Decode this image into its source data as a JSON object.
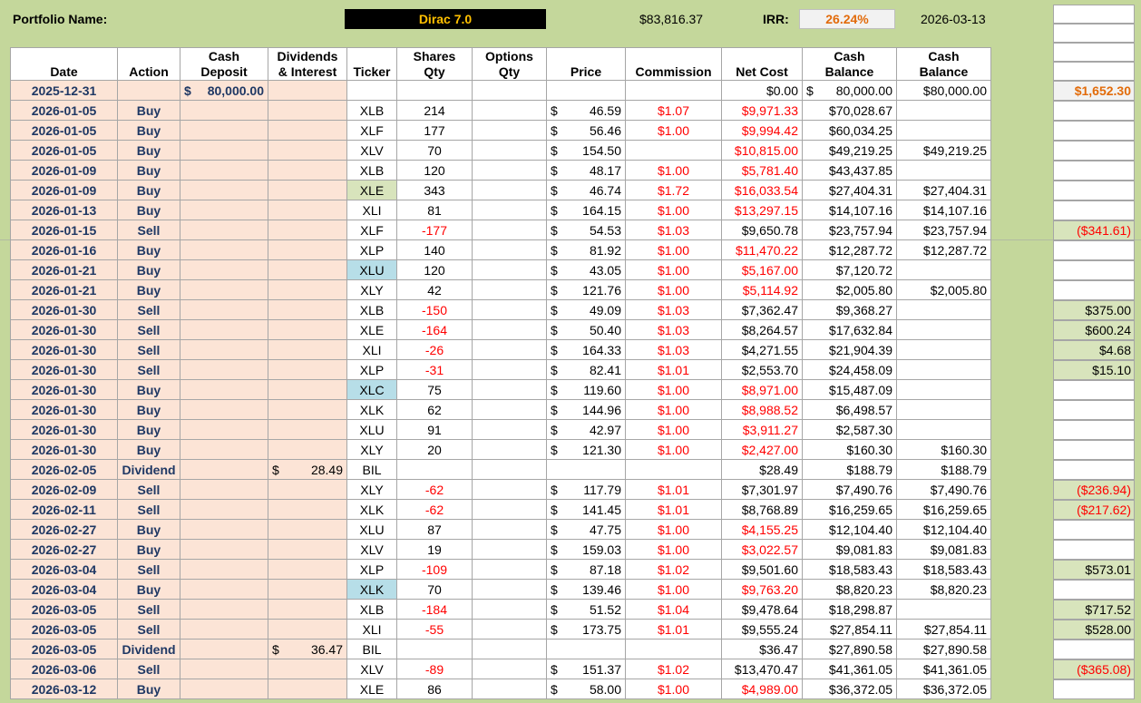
{
  "header": {
    "portfolio_label": "Portfolio Name:",
    "portfolio_name": "Dirac 7.0",
    "total_value": "$83,816.37",
    "irr_label": "IRR:",
    "irr_value": "26.24%",
    "as_of_date": "2026-03-13"
  },
  "columns": {
    "date": "Date",
    "action": "Action",
    "cash_deposit_1": "Cash",
    "cash_deposit_2": "Deposit",
    "dividends_1": "Dividends",
    "dividends_2": "& Interest",
    "ticker": "Ticker",
    "shares_1": "Shares",
    "shares_2": "Qty",
    "options_1": "Options",
    "options_2": "Qty",
    "price": "Price",
    "commission": "Commission",
    "net_cost": "Net Cost",
    "cash_balance_1": "Cash",
    "cash_balance_1b": "Balance",
    "cash_balance_2": "Cash",
    "cash_balance_2b": "Balance"
  },
  "rows": [
    {
      "date": "2025-12-31",
      "action": "",
      "deposit_cur": "$",
      "deposit": "80,000.00",
      "div_cur": "",
      "div": "",
      "ticker": "",
      "ticker_hl": "",
      "shares": "",
      "price_cur": "",
      "price": "",
      "comm": "",
      "net": "$0.00",
      "net_neg": false,
      "cb1_cur": "$",
      "cb1": "80,000.00",
      "cb2": "$80,000.00",
      "side": "$1,652.30",
      "side_style": "orange"
    },
    {
      "date": "2026-01-05",
      "action": "Buy",
      "deposit_cur": "",
      "deposit": "",
      "div_cur": "",
      "div": "",
      "ticker": "XLB",
      "ticker_hl": "",
      "shares": "214",
      "price_cur": "$",
      "price": "46.59",
      "comm": "$1.07",
      "net": "$9,971.33",
      "net_neg": true,
      "cb1_cur": "",
      "cb1": "$70,028.67",
      "cb2": "",
      "side": "",
      "side_style": "blank"
    },
    {
      "date": "2026-01-05",
      "action": "Buy",
      "deposit_cur": "",
      "deposit": "",
      "div_cur": "",
      "div": "",
      "ticker": "XLF",
      "ticker_hl": "",
      "shares": "177",
      "price_cur": "$",
      "price": "56.46",
      "comm": "$1.00",
      "net": "$9,994.42",
      "net_neg": true,
      "cb1_cur": "",
      "cb1": "$60,034.25",
      "cb2": "",
      "side": "",
      "side_style": "blank"
    },
    {
      "date": "2026-01-05",
      "action": "Buy",
      "deposit_cur": "",
      "deposit": "",
      "div_cur": "",
      "div": "",
      "ticker": "XLV",
      "ticker_hl": "",
      "shares": "70",
      "price_cur": "$",
      "price": "154.50",
      "comm": "",
      "net": "$10,815.00",
      "net_neg": true,
      "cb1_cur": "",
      "cb1": "$49,219.25",
      "cb2": "$49,219.25",
      "side": "",
      "side_style": "blank"
    },
    {
      "date": "2026-01-09",
      "action": "Buy",
      "deposit_cur": "",
      "deposit": "",
      "div_cur": "",
      "div": "",
      "ticker": "XLB",
      "ticker_hl": "",
      "shares": "120",
      "price_cur": "$",
      "price": "48.17",
      "comm": "$1.00",
      "net": "$5,781.40",
      "net_neg": true,
      "cb1_cur": "",
      "cb1": "$43,437.85",
      "cb2": "",
      "side": "",
      "side_style": "blank"
    },
    {
      "date": "2026-01-09",
      "action": "Buy",
      "deposit_cur": "",
      "deposit": "",
      "div_cur": "",
      "div": "",
      "ticker": "XLE",
      "ticker_hl": "green",
      "shares": "343",
      "price_cur": "$",
      "price": "46.74",
      "comm": "$1.72",
      "net": "$16,033.54",
      "net_neg": true,
      "cb1_cur": "",
      "cb1": "$27,404.31",
      "cb2": "$27,404.31",
      "side": "",
      "side_style": "blank"
    },
    {
      "date": "2026-01-13",
      "action": "Buy",
      "deposit_cur": "",
      "deposit": "",
      "div_cur": "",
      "div": "",
      "ticker": "XLI",
      "ticker_hl": "",
      "shares": "81",
      "price_cur": "$",
      "price": "164.15",
      "comm": "$1.00",
      "net": "$13,297.15",
      "net_neg": true,
      "cb1_cur": "",
      "cb1": "$14,107.16",
      "cb2": "$14,107.16",
      "side": "",
      "side_style": "blank"
    },
    {
      "date": "2026-01-15",
      "action": "Sell",
      "deposit_cur": "",
      "deposit": "",
      "div_cur": "",
      "div": "",
      "ticker": "XLF",
      "ticker_hl": "",
      "shares": "-177",
      "price_cur": "$",
      "price": "54.53",
      "comm": "$1.03",
      "net": "$9,650.78",
      "net_neg": false,
      "cb1_cur": "",
      "cb1": "$23,757.94",
      "cb2": "$23,757.94",
      "side": "($341.61)",
      "side_style": "loss"
    },
    {
      "date": "2026-01-16",
      "action": "Buy",
      "deposit_cur": "",
      "deposit": "",
      "div_cur": "",
      "div": "",
      "ticker": "XLP",
      "ticker_hl": "",
      "shares": "140",
      "price_cur": "$",
      "price": "81.92",
      "comm": "$1.00",
      "net": "$11,470.22",
      "net_neg": true,
      "cb1_cur": "",
      "cb1": "$12,287.72",
      "cb2": "$12,287.72",
      "side": "",
      "side_style": "blank"
    },
    {
      "date": "2026-01-21",
      "action": "Buy",
      "deposit_cur": "",
      "deposit": "",
      "div_cur": "",
      "div": "",
      "ticker": "XLU",
      "ticker_hl": "blue",
      "shares": "120",
      "price_cur": "$",
      "price": "43.05",
      "comm": "$1.00",
      "net": "$5,167.00",
      "net_neg": true,
      "cb1_cur": "",
      "cb1": "$7,120.72",
      "cb2": "",
      "side": "",
      "side_style": "blank"
    },
    {
      "date": "2026-01-21",
      "action": "Buy",
      "deposit_cur": "",
      "deposit": "",
      "div_cur": "",
      "div": "",
      "ticker": "XLY",
      "ticker_hl": "",
      "shares": "42",
      "price_cur": "$",
      "price": "121.76",
      "comm": "$1.00",
      "net": "$5,114.92",
      "net_neg": true,
      "cb1_cur": "",
      "cb1": "$2,005.80",
      "cb2": "$2,005.80",
      "side": "",
      "side_style": "blank"
    },
    {
      "date": "2026-01-30",
      "action": "Sell",
      "deposit_cur": "",
      "deposit": "",
      "div_cur": "",
      "div": "",
      "ticker": "XLB",
      "ticker_hl": "",
      "shares": "-150",
      "price_cur": "$",
      "price": "49.09",
      "comm": "$1.03",
      "net": "$7,362.47",
      "net_neg": false,
      "cb1_cur": "",
      "cb1": "$9,368.27",
      "cb2": "",
      "side": "$375.00",
      "side_style": "gain"
    },
    {
      "date": "2026-01-30",
      "action": "Sell",
      "deposit_cur": "",
      "deposit": "",
      "div_cur": "",
      "div": "",
      "ticker": "XLE",
      "ticker_hl": "",
      "shares": "-164",
      "price_cur": "$",
      "price": "50.40",
      "comm": "$1.03",
      "net": "$8,264.57",
      "net_neg": false,
      "cb1_cur": "",
      "cb1": "$17,632.84",
      "cb2": "",
      "side": "$600.24",
      "side_style": "gain"
    },
    {
      "date": "2026-01-30",
      "action": "Sell",
      "deposit_cur": "",
      "deposit": "",
      "div_cur": "",
      "div": "",
      "ticker": "XLI",
      "ticker_hl": "",
      "shares": "-26",
      "price_cur": "$",
      "price": "164.33",
      "comm": "$1.03",
      "net": "$4,271.55",
      "net_neg": false,
      "cb1_cur": "",
      "cb1": "$21,904.39",
      "cb2": "",
      "side": "$4.68",
      "side_style": "gain"
    },
    {
      "date": "2026-01-30",
      "action": "Sell",
      "deposit_cur": "",
      "deposit": "",
      "div_cur": "",
      "div": "",
      "ticker": "XLP",
      "ticker_hl": "",
      "shares": "-31",
      "price_cur": "$",
      "price": "82.41",
      "comm": "$1.01",
      "net": "$2,553.70",
      "net_neg": false,
      "cb1_cur": "",
      "cb1": "$24,458.09",
      "cb2": "",
      "side": "$15.10",
      "side_style": "gain"
    },
    {
      "date": "2026-01-30",
      "action": "Buy",
      "deposit_cur": "",
      "deposit": "",
      "div_cur": "",
      "div": "",
      "ticker": "XLC",
      "ticker_hl": "blue",
      "shares": "75",
      "price_cur": "$",
      "price": "119.60",
      "comm": "$1.00",
      "net": "$8,971.00",
      "net_neg": true,
      "cb1_cur": "",
      "cb1": "$15,487.09",
      "cb2": "",
      "side": "",
      "side_style": "blank"
    },
    {
      "date": "2026-01-30",
      "action": "Buy",
      "deposit_cur": "",
      "deposit": "",
      "div_cur": "",
      "div": "",
      "ticker": "XLK",
      "ticker_hl": "",
      "shares": "62",
      "price_cur": "$",
      "price": "144.96",
      "comm": "$1.00",
      "net": "$8,988.52",
      "net_neg": true,
      "cb1_cur": "",
      "cb1": "$6,498.57",
      "cb2": "",
      "side": "",
      "side_style": "blank"
    },
    {
      "date": "2026-01-30",
      "action": "Buy",
      "deposit_cur": "",
      "deposit": "",
      "div_cur": "",
      "div": "",
      "ticker": "XLU",
      "ticker_hl": "",
      "shares": "91",
      "price_cur": "$",
      "price": "42.97",
      "comm": "$1.00",
      "net": "$3,911.27",
      "net_neg": true,
      "cb1_cur": "",
      "cb1": "$2,587.30",
      "cb2": "",
      "side": "",
      "side_style": "blank"
    },
    {
      "date": "2026-01-30",
      "action": "Buy",
      "deposit_cur": "",
      "deposit": "",
      "div_cur": "",
      "div": "",
      "ticker": "XLY",
      "ticker_hl": "",
      "shares": "20",
      "price_cur": "$",
      "price": "121.30",
      "comm": "$1.00",
      "net": "$2,427.00",
      "net_neg": true,
      "cb1_cur": "",
      "cb1": "$160.30",
      "cb2": "$160.30",
      "side": "",
      "side_style": "blank"
    },
    {
      "date": "2026-02-05",
      "action": "Dividend",
      "deposit_cur": "",
      "deposit": "",
      "div_cur": "$",
      "div": "28.49",
      "ticker": "BIL",
      "ticker_hl": "",
      "shares": "",
      "price_cur": "",
      "price": "",
      "comm": "",
      "net": "$28.49",
      "net_neg": false,
      "cb1_cur": "",
      "cb1": "$188.79",
      "cb2": "$188.79",
      "side": "",
      "side_style": "blank"
    },
    {
      "date": "2026-02-09",
      "action": "Sell",
      "deposit_cur": "",
      "deposit": "",
      "div_cur": "",
      "div": "",
      "ticker": "XLY",
      "ticker_hl": "",
      "shares": "-62",
      "price_cur": "$",
      "price": "117.79",
      "comm": "$1.01",
      "net": "$7,301.97",
      "net_neg": false,
      "cb1_cur": "",
      "cb1": "$7,490.76",
      "cb2": "$7,490.76",
      "side": "($236.94)",
      "side_style": "loss"
    },
    {
      "date": "2026-02-11",
      "action": "Sell",
      "deposit_cur": "",
      "deposit": "",
      "div_cur": "",
      "div": "",
      "ticker": "XLK",
      "ticker_hl": "",
      "shares": "-62",
      "price_cur": "$",
      "price": "141.45",
      "comm": "$1.01",
      "net": "$8,768.89",
      "net_neg": false,
      "cb1_cur": "",
      "cb1": "$16,259.65",
      "cb2": "$16,259.65",
      "side": "($217.62)",
      "side_style": "loss"
    },
    {
      "date": "2026-02-27",
      "action": "Buy",
      "deposit_cur": "",
      "deposit": "",
      "div_cur": "",
      "div": "",
      "ticker": "XLU",
      "ticker_hl": "",
      "shares": "87",
      "price_cur": "$",
      "price": "47.75",
      "comm": "$1.00",
      "net": "$4,155.25",
      "net_neg": true,
      "cb1_cur": "",
      "cb1": "$12,104.40",
      "cb2": "$12,104.40",
      "side": "",
      "side_style": "blank"
    },
    {
      "date": "2026-02-27",
      "action": "Buy",
      "deposit_cur": "",
      "deposit": "",
      "div_cur": "",
      "div": "",
      "ticker": "XLV",
      "ticker_hl": "",
      "shares": "19",
      "price_cur": "$",
      "price": "159.03",
      "comm": "$1.00",
      "net": "$3,022.57",
      "net_neg": true,
      "cb1_cur": "",
      "cb1": "$9,081.83",
      "cb2": "$9,081.83",
      "side": "",
      "side_style": "blank"
    },
    {
      "date": "2026-03-04",
      "action": "Sell",
      "deposit_cur": "",
      "deposit": "",
      "div_cur": "",
      "div": "",
      "ticker": "XLP",
      "ticker_hl": "",
      "shares": "-109",
      "price_cur": "$",
      "price": "87.18",
      "comm": "$1.02",
      "net": "$9,501.60",
      "net_neg": false,
      "cb1_cur": "",
      "cb1": "$18,583.43",
      "cb2": "$18,583.43",
      "side": "$573.01",
      "side_style": "gain"
    },
    {
      "date": "2026-03-04",
      "action": "Buy",
      "deposit_cur": "",
      "deposit": "",
      "div_cur": "",
      "div": "",
      "ticker": "XLK",
      "ticker_hl": "blue",
      "shares": "70",
      "price_cur": "$",
      "price": "139.46",
      "comm": "$1.00",
      "net": "$9,763.20",
      "net_neg": true,
      "cb1_cur": "",
      "cb1": "$8,820.23",
      "cb2": "$8,820.23",
      "side": "",
      "side_style": "blank"
    },
    {
      "date": "2026-03-05",
      "action": "Sell",
      "deposit_cur": "",
      "deposit": "",
      "div_cur": "",
      "div": "",
      "ticker": "XLB",
      "ticker_hl": "",
      "shares": "-184",
      "price_cur": "$",
      "price": "51.52",
      "comm": "$1.04",
      "net": "$9,478.64",
      "net_neg": false,
      "cb1_cur": "",
      "cb1": "$18,298.87",
      "cb2": "",
      "side": "$717.52",
      "side_style": "gain"
    },
    {
      "date": "2026-03-05",
      "action": "Sell",
      "deposit_cur": "",
      "deposit": "",
      "div_cur": "",
      "div": "",
      "ticker": "XLI",
      "ticker_hl": "",
      "shares": "-55",
      "price_cur": "$",
      "price": "173.75",
      "comm": "$1.01",
      "net": "$9,555.24",
      "net_neg": false,
      "cb1_cur": "",
      "cb1": "$27,854.11",
      "cb2": "$27,854.11",
      "side": "$528.00",
      "side_style": "gain"
    },
    {
      "date": "2026-03-05",
      "action": "Dividend",
      "deposit_cur": "",
      "deposit": "",
      "div_cur": "$",
      "div": "36.47",
      "ticker": "BIL",
      "ticker_hl": "",
      "shares": "",
      "price_cur": "",
      "price": "",
      "comm": "",
      "net": "$36.47",
      "net_neg": false,
      "cb1_cur": "",
      "cb1": "$27,890.58",
      "cb2": "$27,890.58",
      "side": "",
      "side_style": "blank"
    },
    {
      "date": "2026-03-06",
      "action": "Sell",
      "deposit_cur": "",
      "deposit": "",
      "div_cur": "",
      "div": "",
      "ticker": "XLV",
      "ticker_hl": "",
      "shares": "-89",
      "price_cur": "$",
      "price": "151.37",
      "comm": "$1.02",
      "net": "$13,470.47",
      "net_neg": false,
      "cb1_cur": "",
      "cb1": "$41,361.05",
      "cb2": "$41,361.05",
      "side": "($365.08)",
      "side_style": "loss"
    },
    {
      "date": "2026-03-12",
      "action": "Buy",
      "deposit_cur": "",
      "deposit": "",
      "div_cur": "",
      "div": "",
      "ticker": "XLE",
      "ticker_hl": "",
      "shares": "86",
      "price_cur": "$",
      "price": "58.00",
      "comm": "$1.00",
      "net": "$4,989.00",
      "net_neg": true,
      "cb1_cur": "",
      "cb1": "$36,372.05",
      "cb2": "$36,372.05",
      "side": "",
      "side_style": "blank"
    }
  ],
  "colors": {
    "sheet_bg": "#c4d79b",
    "row_bg": "#fce4d6",
    "negative": "#ff0000",
    "irr": "#e26b0a",
    "portfolio_name_text": "#ffc000"
  }
}
